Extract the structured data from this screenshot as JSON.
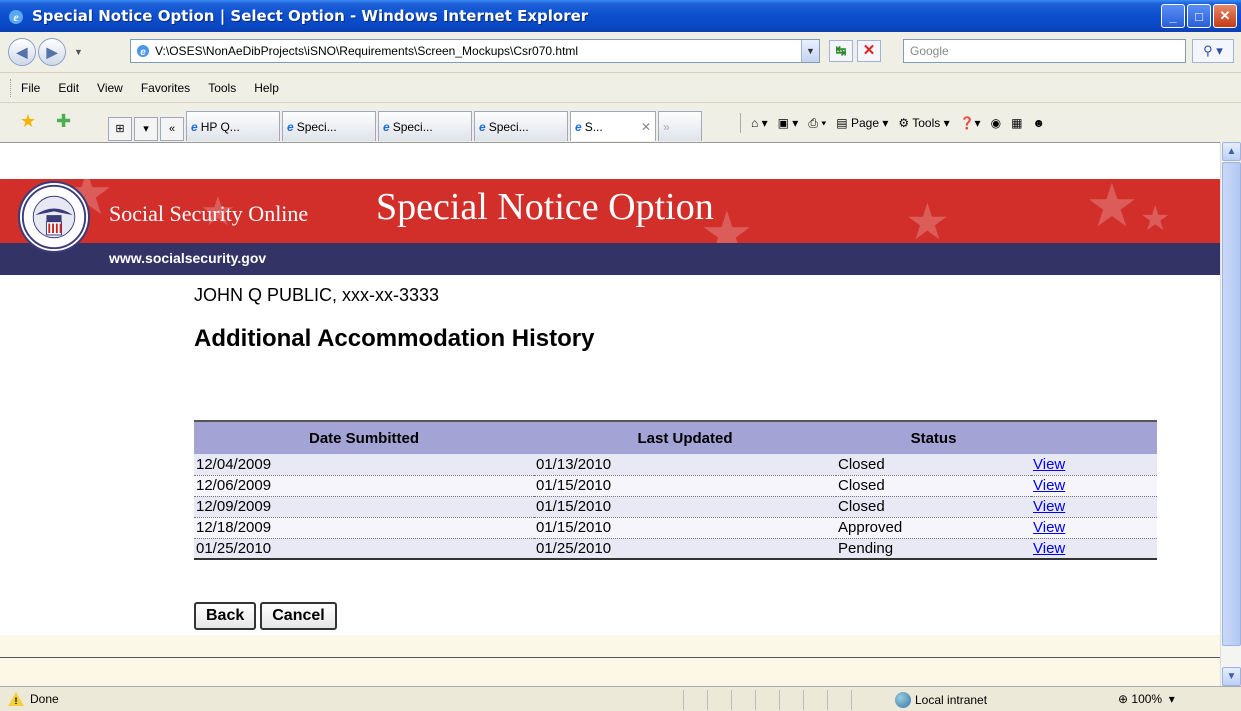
{
  "window": {
    "title": "Special Notice Option | Select Option - Windows Internet Explorer"
  },
  "toolbar": {
    "address": "V:\\OSES\\NonAeDibProjects\\iSNO\\Requirements\\Screen_Mockups\\Csr070.html",
    "search_placeholder": "Google"
  },
  "menu": [
    "File",
    "Edit",
    "View",
    "Favorites",
    "Tools",
    "Help"
  ],
  "tabs": [
    {
      "label": "HP Q..."
    },
    {
      "label": "Speci..."
    },
    {
      "label": "Speci..."
    },
    {
      "label": "Speci..."
    },
    {
      "label": "S..."
    }
  ],
  "commandbar": {
    "page_label": "Page",
    "tools_label": "Tools"
  },
  "banner": {
    "site_name": "Social Security Online",
    "app_title": "Special Notice Option",
    "url": "www.socialsecurity.gov"
  },
  "page": {
    "person": "JOHN Q PUBLIC, xxx-xx-3333",
    "title": "Additional Accommodation History"
  },
  "table": {
    "headers": [
      "Date Sumbitted",
      "Last Updated",
      "Status"
    ],
    "rows": [
      {
        "submitted": "12/04/2009",
        "updated": "01/13/2010",
        "status": "Closed",
        "action": "View"
      },
      {
        "submitted": "12/06/2009",
        "updated": "01/15/2010",
        "status": "Closed",
        "action": "View"
      },
      {
        "submitted": "12/09/2009",
        "updated": "01/15/2010",
        "status": "Closed",
        "action": "View"
      },
      {
        "submitted": "12/18/2009",
        "updated": "01/15/2010",
        "status": "Approved",
        "action": "View"
      },
      {
        "submitted": "01/25/2010",
        "updated": "01/25/2010",
        "status": "Pending",
        "action": "View"
      }
    ]
  },
  "buttons": {
    "back": "Back",
    "cancel": "Cancel"
  },
  "statusbar": {
    "status": "Done",
    "zone": "Local intranet",
    "zoom": "100%"
  },
  "colors": {
    "banner_red": "#D22F2B",
    "banner_navy": "#333366",
    "table_header": "#A3A3D6",
    "link": "#0000EE"
  }
}
